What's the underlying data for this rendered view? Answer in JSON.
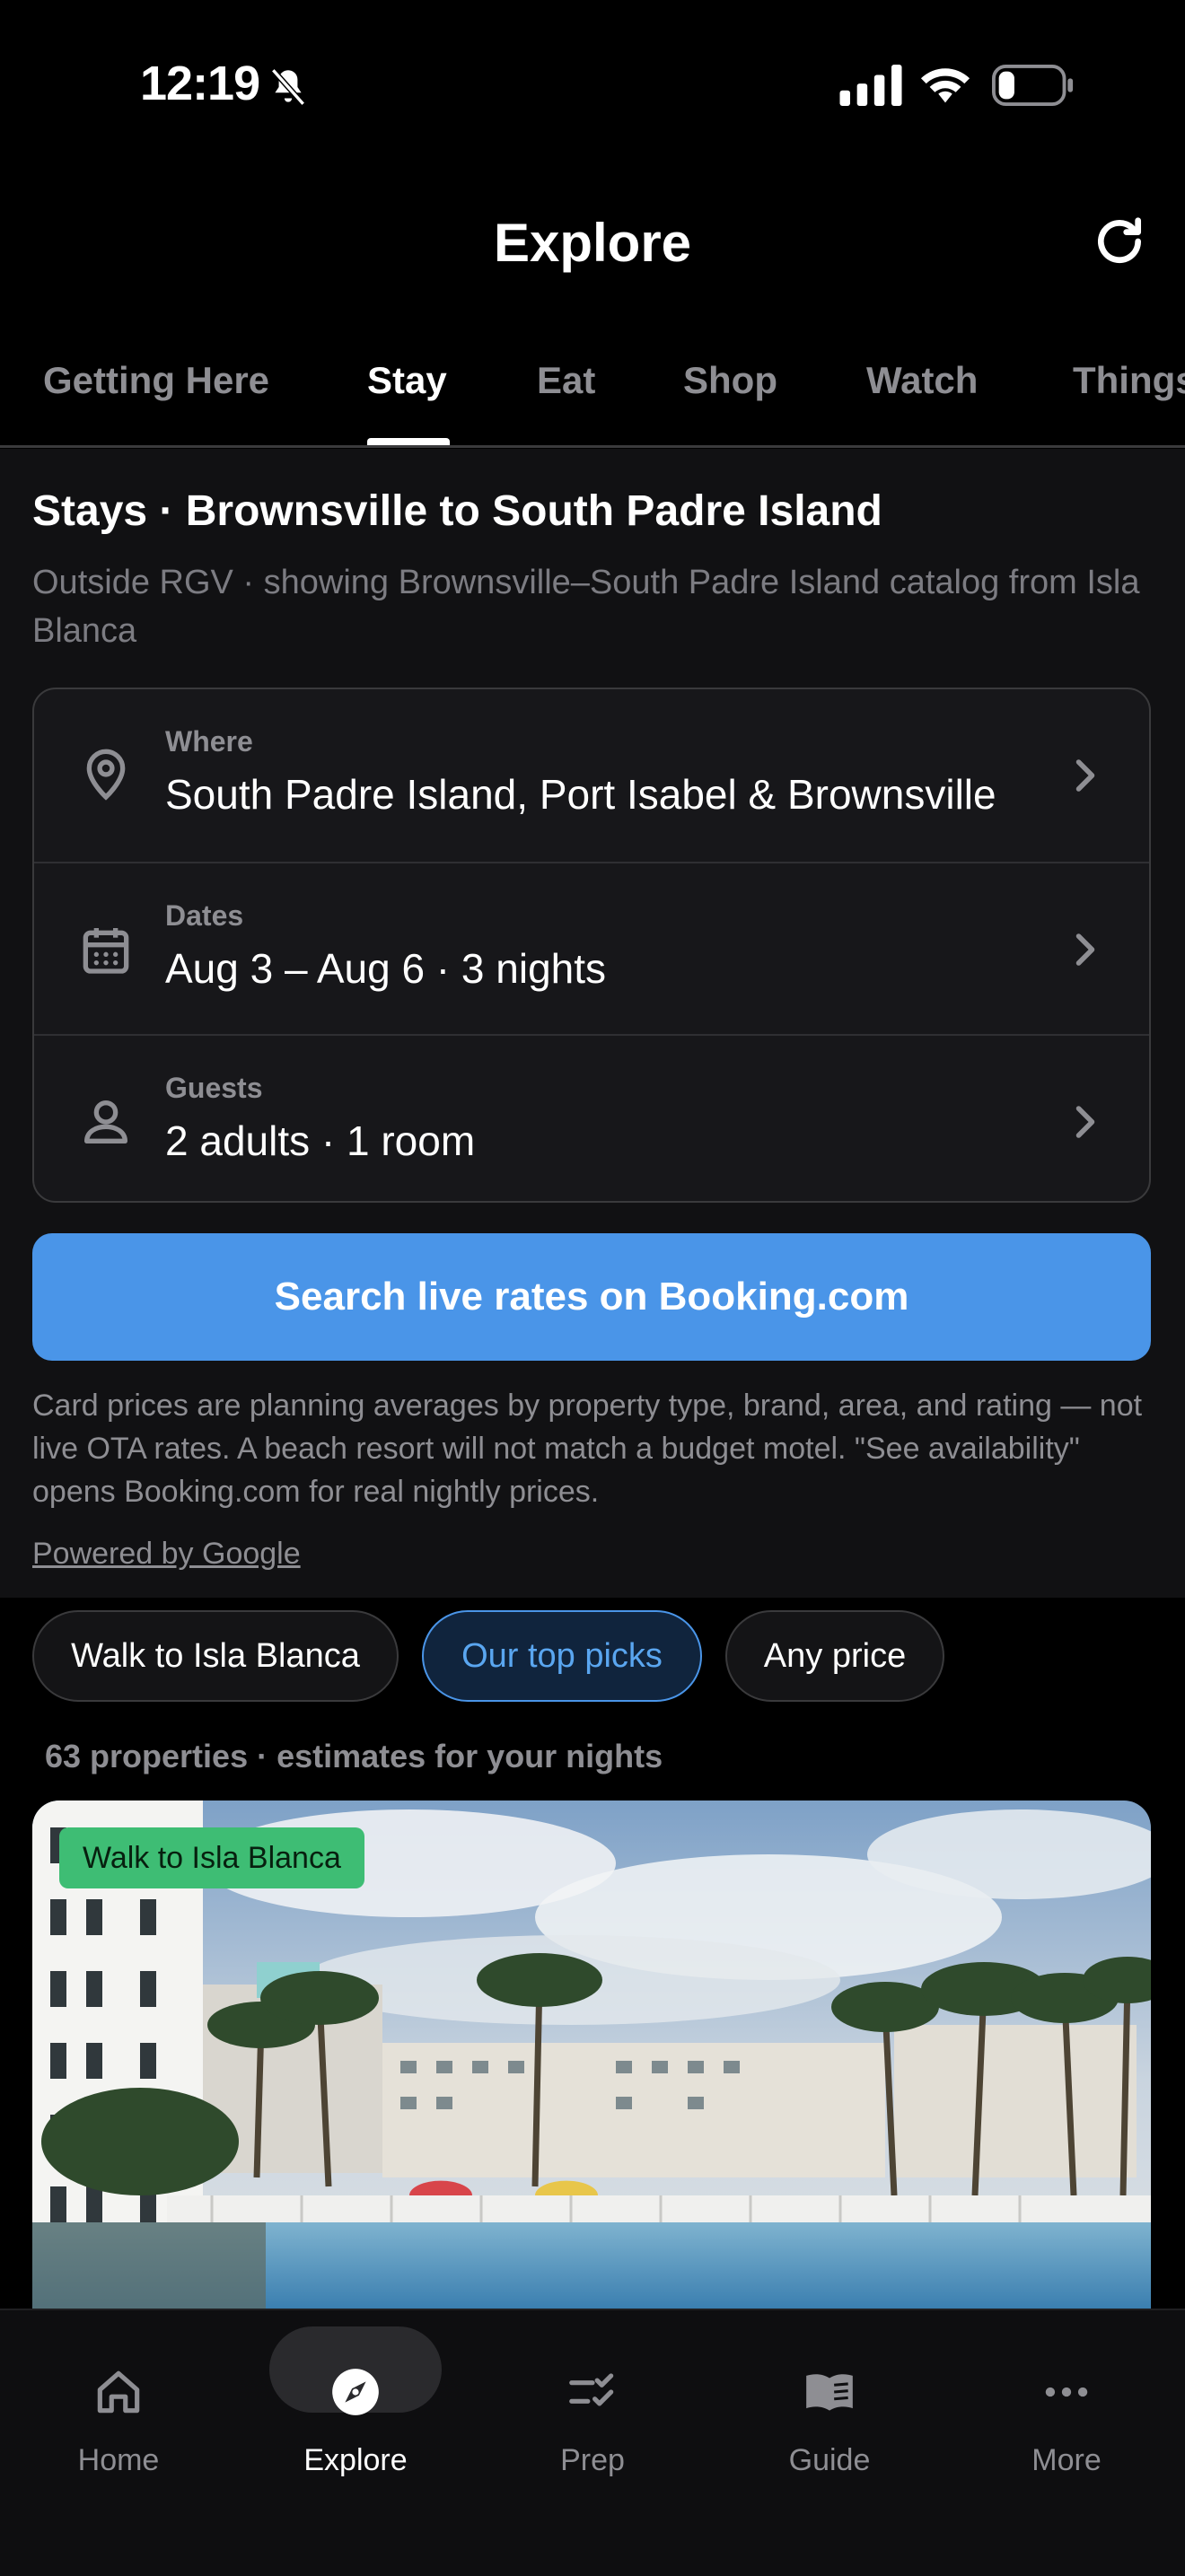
{
  "status_bar": {
    "time": "12:19"
  },
  "header": {
    "title": "Explore"
  },
  "tabs": [
    {
      "label": "Getting Here"
    },
    {
      "label": "Stay"
    },
    {
      "label": "Eat"
    },
    {
      "label": "Shop"
    },
    {
      "label": "Watch"
    },
    {
      "label": "Things"
    }
  ],
  "stays": {
    "title": "Stays · Brownsville to South Padre Island",
    "subtitle": "Outside RGV · showing Brownsville–South Padre Island catalog from Isla Blanca",
    "where_label": "Where",
    "where_value": "South Padre Island, Port Isabel & Brownsville",
    "dates_label": "Dates",
    "dates_value": "Aug 3 – Aug 6 · 3 nights",
    "guests_label": "Guests",
    "guests_value": "2 adults · 1 room",
    "search_button": "Search live rates on Booking.com",
    "disclaimer": "Card prices are planning averages by property type, brand, area, and rating — not live OTA rates. A beach resort will not match a budget motel. \"See availability\" opens Booking.com for real nightly prices.",
    "powered_by": "Powered by Google"
  },
  "filters": [
    {
      "label": "Walk to Isla Blanca",
      "active": false
    },
    {
      "label": "Our top picks",
      "active": true
    },
    {
      "label": "Any price",
      "active": false
    }
  ],
  "results_count": "63 properties · estimates for your nights",
  "property": {
    "badge": "Walk to Isla Blanca"
  },
  "bottom_nav": [
    {
      "label": "Home",
      "icon": "home-icon"
    },
    {
      "label": "Explore",
      "icon": "compass-icon",
      "active": true
    },
    {
      "label": "Prep",
      "icon": "checklist-icon"
    },
    {
      "label": "Guide",
      "icon": "book-icon"
    },
    {
      "label": "More",
      "icon": "more-icon"
    }
  ],
  "colors": {
    "accent": "#4a95e8",
    "badge": "#3ebd74",
    "background": "#000000",
    "surface": "#111113"
  }
}
